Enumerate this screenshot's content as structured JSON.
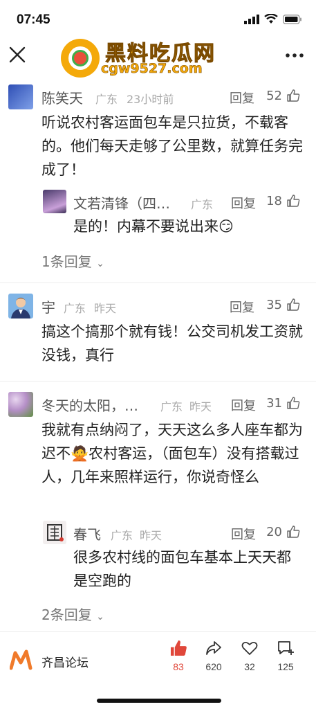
{
  "status_bar": {
    "time": "07:45"
  },
  "logo": {
    "cn": "黑料吃瓜网",
    "url": "cgw9527.com"
  },
  "comments": [
    {
      "name": "陈笑天",
      "location": "广东",
      "time": "23小时前",
      "reply": "回复",
      "likes": "52",
      "text": "听说农村客运面包车是只拉货，不载客的。他们每天走够了公里数，就算任务完成了！",
      "replies": [
        {
          "name": "文若清锋（四…",
          "location": "广东",
          "reply": "回复",
          "likes": "18",
          "text": "是的！内幕不要说出来😏"
        }
      ],
      "expand": "1条回复"
    },
    {
      "name": "宇",
      "location": "广东",
      "time": "昨天",
      "reply": "回复",
      "likes": "35",
      "text": "搞这个搞那个就有钱！公交司机发工资就没钱，真行"
    },
    {
      "name": "冬天的太阳，…",
      "location": "广东",
      "time": "昨天",
      "reply": "回复",
      "likes": "31",
      "text": "我就有点纳闷了，天天这么多人座车都为迟不🙅农村客运，（面包车）没有搭载过人，几年来照样运行，你说奇怪么",
      "replies": [
        {
          "name": "春飞",
          "location": "广东",
          "time": "昨天",
          "reply": "回复",
          "likes": "20",
          "text": "很多农村线的面包车基本上天天都是空跑的"
        }
      ],
      "expand": "2条回复"
    }
  ],
  "bottom_bar": {
    "forum_name": "齐昌论坛",
    "like_count": "83",
    "share_count": "620",
    "favorite_count": "32",
    "comment_count": "125",
    "accent": "#e0473a"
  }
}
